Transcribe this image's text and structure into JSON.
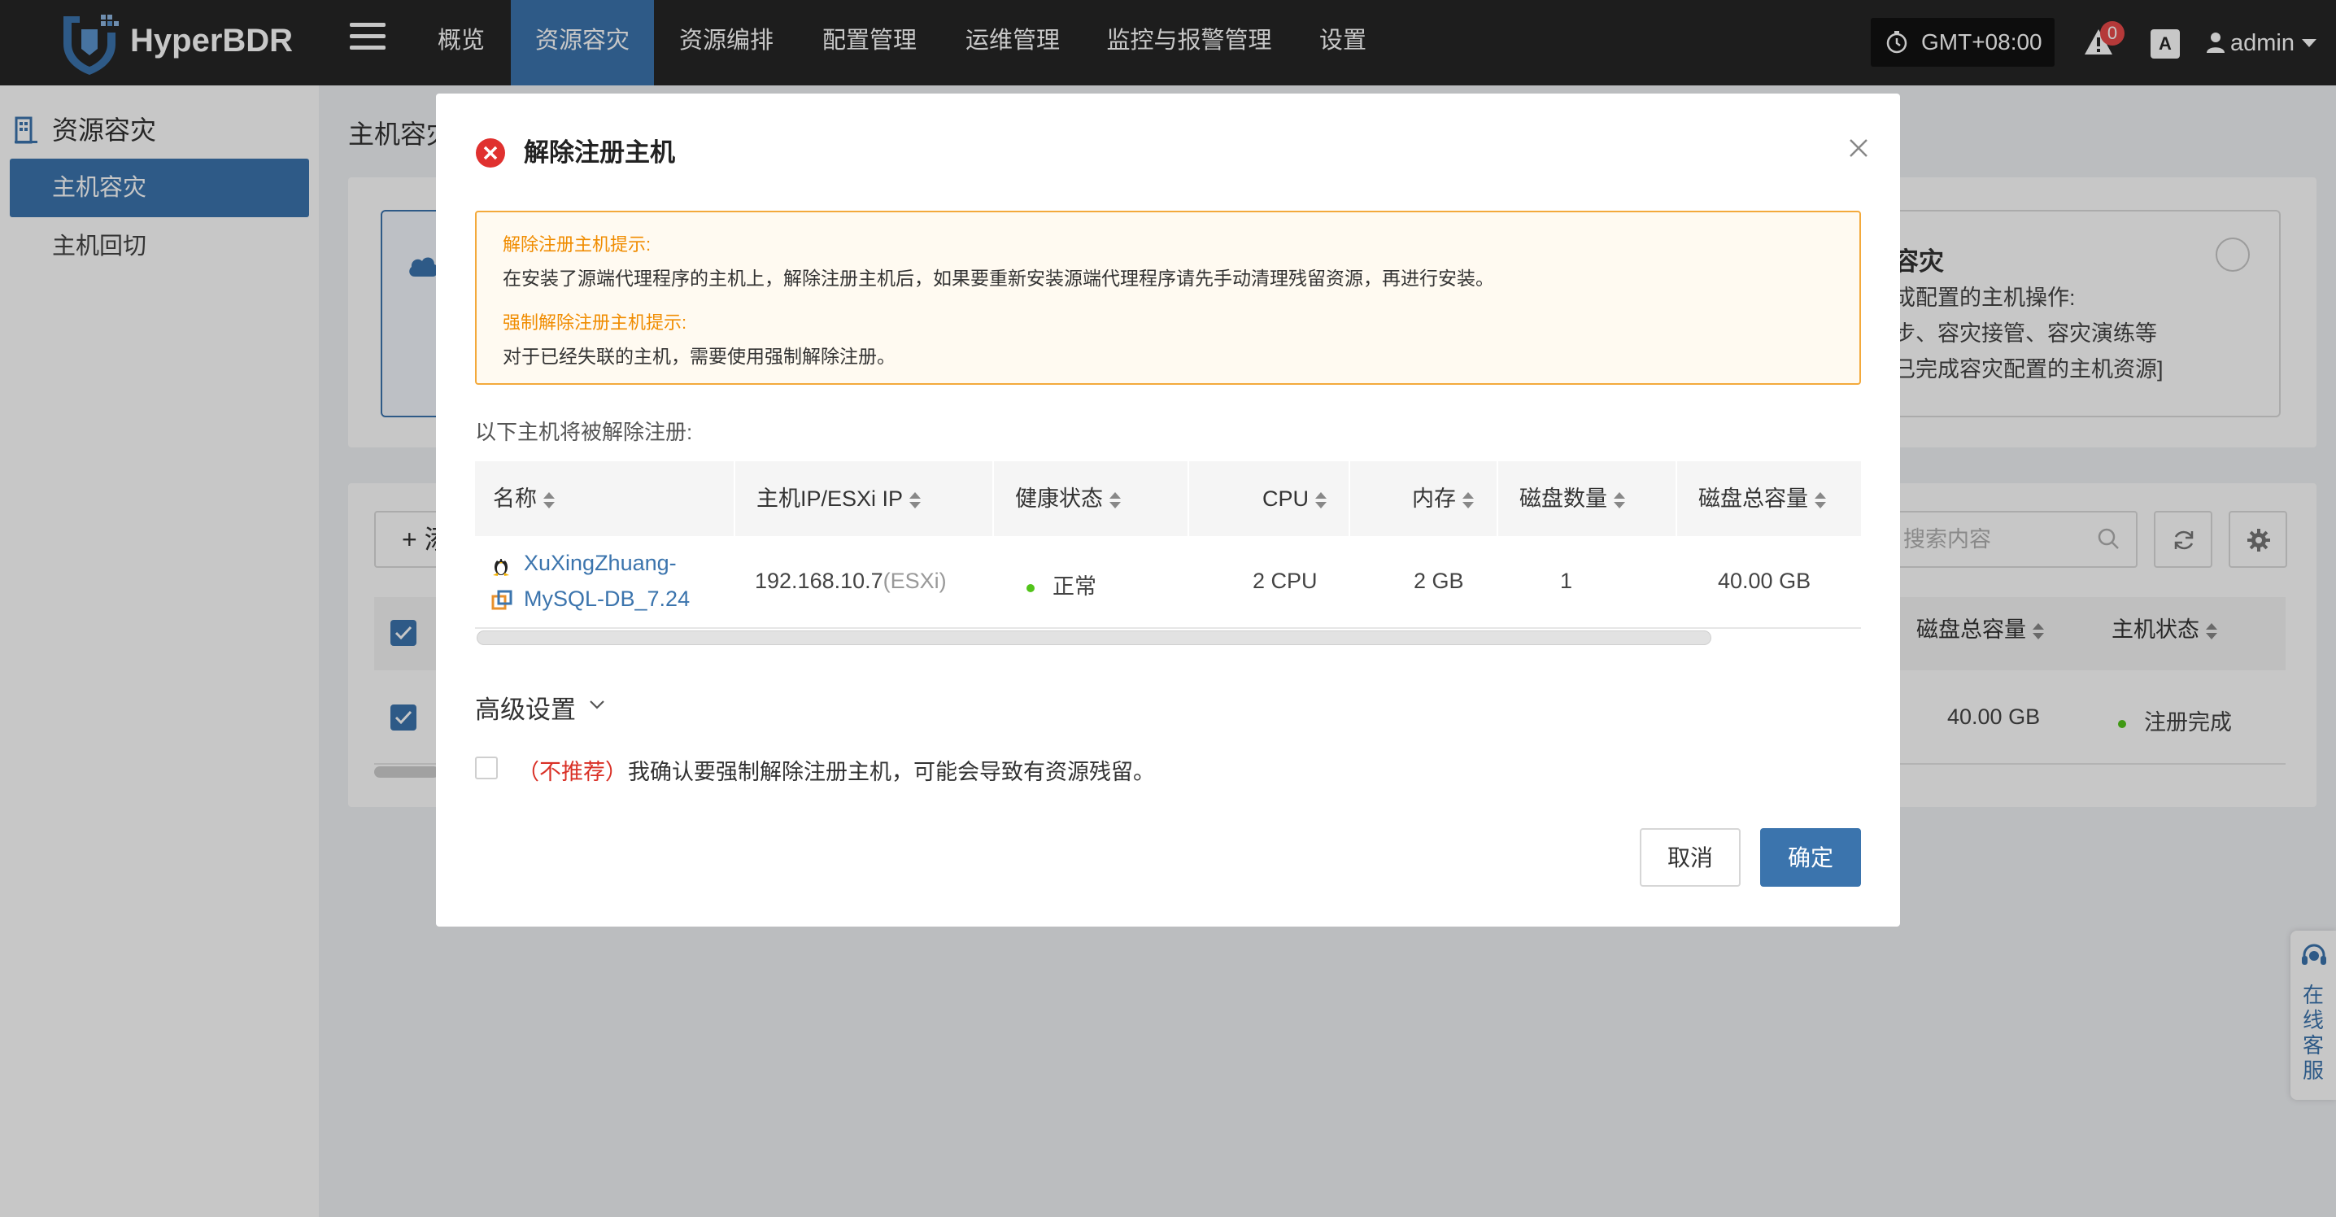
{
  "app": {
    "brand": "HyperBDR"
  },
  "nav": {
    "items": [
      {
        "label": "概览"
      },
      {
        "label": "资源容灾"
      },
      {
        "label": "资源编排"
      },
      {
        "label": "配置管理"
      },
      {
        "label": "运维管理"
      },
      {
        "label": "监控与报警管理"
      },
      {
        "label": "设置"
      }
    ],
    "active_index": 1,
    "timezone": "GMT+08:00",
    "notification_count": "0",
    "lang_label": "A",
    "user": "admin"
  },
  "sidebar": {
    "section_title": "资源容灾",
    "items": [
      {
        "label": "主机容灾"
      },
      {
        "label": "主机回切"
      }
    ]
  },
  "background": {
    "page_title": "主机容灾",
    "option_right": {
      "title": "容灾",
      "line1": "成配置的主机操作:",
      "line2": "步、容灾接管、容灾演练等",
      "line3": "已完成容灾配置的主机资源]"
    },
    "add_button": "+ 添",
    "search_placeholder": "搜索内容",
    "table_headers": {
      "disk_total": "磁盘总容量",
      "host_status": "主机状态"
    },
    "row": {
      "disk_total": "40.00 GB",
      "host_status": "注册完成"
    }
  },
  "dialog": {
    "title": "解除注册主机",
    "warning": {
      "heading1": "解除注册主机提示:",
      "text1": "在安装了源端代理程序的主机上，解除注册主机后，如果要重新安装源端代理程序请先手动清理残留资源，再进行安装。",
      "heading2": "强制解除注册主机提示:",
      "text2": "对于已经失联的主机，需要使用强制解除注册。"
    },
    "list_label": "以下主机将被解除注册:",
    "table": {
      "headers": {
        "name": "名称",
        "ip": "主机IP/ESXi IP",
        "health": "健康状态",
        "cpu": "CPU",
        "memory": "内存",
        "disk_count": "磁盘数量",
        "disk_total": "磁盘总容量"
      },
      "rows": [
        {
          "name_line1": "XuXingZhuang-",
          "name_line2": "MySQL-DB_7.24",
          "ip": "192.168.10.7",
          "ip_suffix": "(ESXi)",
          "health": "正常",
          "cpu": "2 CPU",
          "memory": "2 GB",
          "disk_count": "1",
          "disk_total": "40.00 GB"
        }
      ]
    },
    "advanced_label": "高级设置",
    "force_checkbox": {
      "checked": false,
      "tag": "（不推荐）",
      "text": "我确认要强制解除注册主机，可能会导致有资源残留。"
    },
    "cancel_label": "取消",
    "ok_label": "确定"
  },
  "online_service": {
    "label": "在线客服"
  },
  "colors": {
    "accent": "#3b74ad",
    "topbar": "#262626",
    "warning": "#f3a93b",
    "danger": "#d93026",
    "ok": "#52c41a"
  }
}
